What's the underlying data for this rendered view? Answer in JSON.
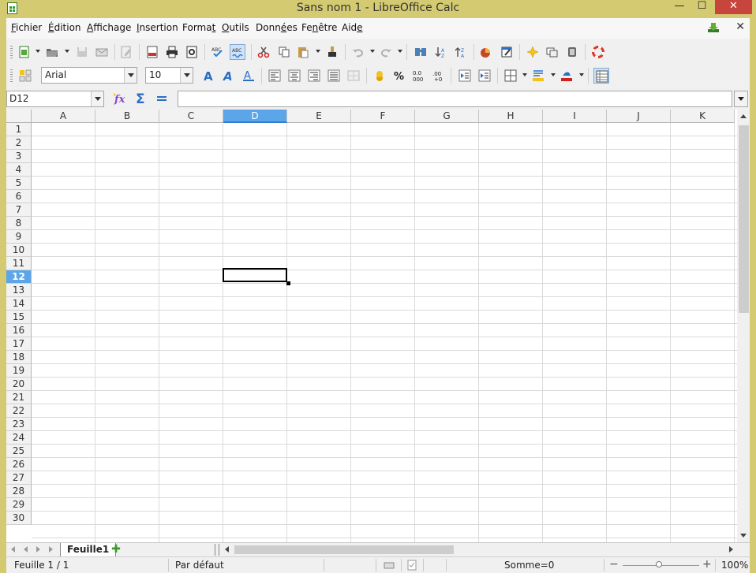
{
  "window": {
    "title": "Sans nom 1 - LibreOffice Calc",
    "min_glyph": "—",
    "max_glyph": "☐",
    "close_glyph": "✕"
  },
  "menu": {
    "items": [
      {
        "accel": "F",
        "rest": "ichier"
      },
      {
        "accel": "É",
        "rest": "dition"
      },
      {
        "accel": "A",
        "rest": "ffichage"
      },
      {
        "accel": "I",
        "rest": "nsertion"
      },
      {
        "pre": "Forma",
        "accel": "t",
        "rest": ""
      },
      {
        "accel": "O",
        "rest": "utils"
      },
      {
        "pre": "Donn",
        "accel": "é",
        "rest": "es"
      },
      {
        "pre": "Fe",
        "accel": "n",
        "rest": "être"
      },
      {
        "pre": "Aid",
        "accel": "e",
        "rest": ""
      }
    ],
    "close_glyph": "✕"
  },
  "formatting": {
    "font_name": "Arial",
    "font_size": "10"
  },
  "formula_bar": {
    "cell_reference": "D12",
    "formula": ""
  },
  "grid": {
    "columns": [
      "A",
      "B",
      "C",
      "D",
      "E",
      "F",
      "G",
      "H",
      "I",
      "J",
      "K"
    ],
    "rows": [
      "1",
      "2",
      "3",
      "4",
      "5",
      "6",
      "7",
      "8",
      "9",
      "10",
      "11",
      "12",
      "13",
      "14",
      "15",
      "16",
      "17",
      "18",
      "19",
      "20",
      "21",
      "22",
      "23",
      "24",
      "25",
      "26",
      "27",
      "28",
      "29",
      "30"
    ],
    "selected_column": "D",
    "selected_row": "12"
  },
  "sheets": {
    "tabs": [
      "Feuille1"
    ],
    "add_glyph": "✚"
  },
  "status": {
    "sheet_position": "Feuille 1 / 1",
    "page_style": "Par défaut",
    "sum": "Somme=0",
    "zoom": "100%",
    "zoom_minus": "−",
    "zoom_plus": "+"
  },
  "colors": {
    "window_frame": "#d4ca71",
    "selection": "#5ca5e9",
    "close_button": "#c7453c"
  }
}
